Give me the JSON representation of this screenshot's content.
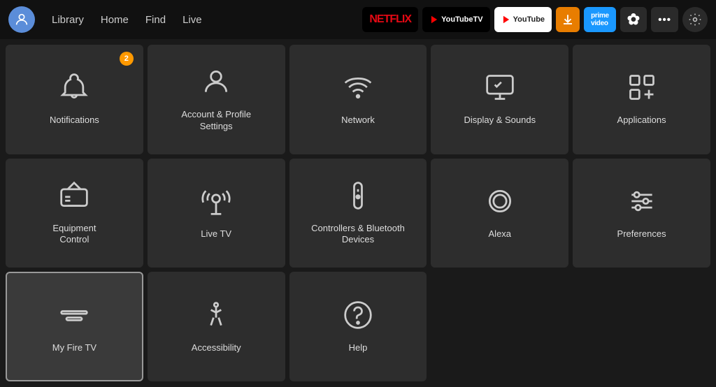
{
  "nav": {
    "links": [
      "Library",
      "Home",
      "Find",
      "Live"
    ],
    "apps": [
      {
        "name": "Netflix",
        "label": "NETFLIX",
        "class": "app-netflix"
      },
      {
        "name": "YouTubeTV",
        "label": "▶ YouTubeTV",
        "class": "app-youtubetv"
      },
      {
        "name": "YouTube",
        "label": "▶ YouTube",
        "class": "app-youtube"
      },
      {
        "name": "Downloader",
        "label": "⬇",
        "class": "app-downloader"
      },
      {
        "name": "PrimeVideo",
        "label": "prime video",
        "class": "app-prime"
      },
      {
        "name": "Flower",
        "label": "✿",
        "class": "app-flower"
      },
      {
        "name": "More",
        "label": "•••",
        "class": "app-more"
      }
    ]
  },
  "grid": {
    "items": [
      {
        "id": "notifications",
        "label": "Notifications",
        "badge": "2",
        "icon": "bell"
      },
      {
        "id": "account",
        "label": "Account & Profile\nSettings",
        "icon": "person"
      },
      {
        "id": "network",
        "label": "Network",
        "icon": "wifi"
      },
      {
        "id": "display",
        "label": "Display & Sounds",
        "icon": "display"
      },
      {
        "id": "applications",
        "label": "Applications",
        "icon": "apps"
      },
      {
        "id": "equipment",
        "label": "Equipment\nControl",
        "icon": "tv"
      },
      {
        "id": "livetv",
        "label": "Live TV",
        "icon": "antenna"
      },
      {
        "id": "controllers",
        "label": "Controllers & Bluetooth\nDevices",
        "icon": "remote"
      },
      {
        "id": "alexa",
        "label": "Alexa",
        "icon": "alexa"
      },
      {
        "id": "preferences",
        "label": "Preferences",
        "icon": "sliders"
      },
      {
        "id": "myfiretv",
        "label": "My Fire TV",
        "icon": "firetv",
        "selected": true
      },
      {
        "id": "accessibility",
        "label": "Accessibility",
        "icon": "accessibility"
      },
      {
        "id": "help",
        "label": "Help",
        "icon": "help"
      },
      {
        "id": "empty1",
        "label": "",
        "icon": ""
      },
      {
        "id": "empty2",
        "label": "",
        "icon": ""
      }
    ]
  }
}
